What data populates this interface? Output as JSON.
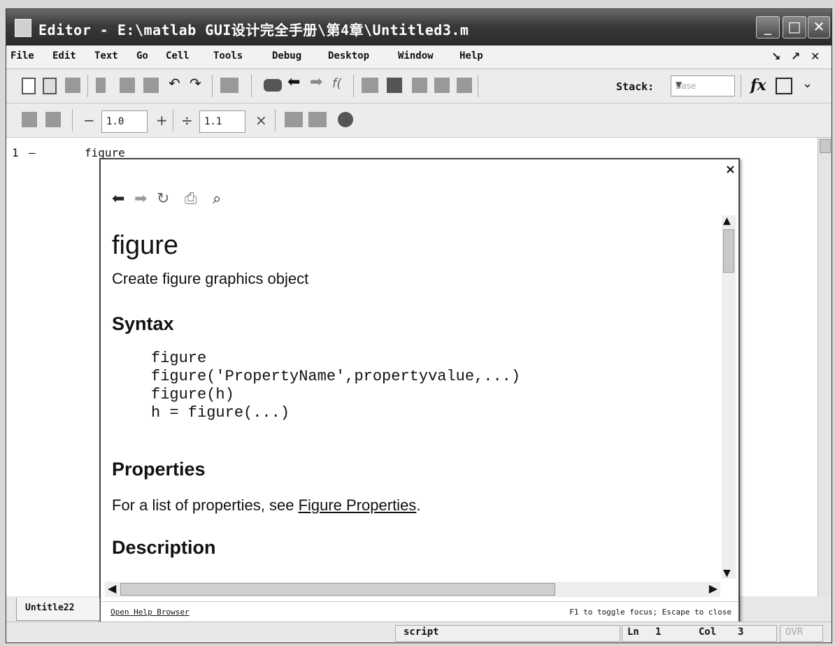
{
  "window": {
    "title": "Editor - E:\\matlab GUI设计完全手册\\第4章\\Untitled3.m",
    "controls": {
      "minimize": "_",
      "maximize": "□",
      "close": "✕"
    }
  },
  "menu": {
    "items": [
      "File",
      "Edit",
      "Text",
      "Go",
      "Cell",
      "Tools",
      "Debug",
      "Desktop",
      "Window",
      "Help"
    ],
    "right": [
      "↘",
      "↗",
      "✕"
    ]
  },
  "toolbar1": {
    "stack_label": "Stack:",
    "stack_value": "Base",
    "fx_label": "fx",
    "icons": [
      "new-file-icon",
      "open-file-icon",
      "save-icon",
      "cut-icon",
      "copy-icon",
      "paste-icon",
      "undo-icon",
      "redo-icon",
      "print-icon",
      "find-icon",
      "back-icon",
      "forward-icon",
      "function-icon",
      "run-icon",
      "breakpoint-icon",
      "step-icon",
      "step-in-icon",
      "step-out-icon"
    ]
  },
  "toolbar2": {
    "field1": "1.0",
    "field2": "1.1",
    "minus": "−",
    "plus": "+",
    "divide": "÷",
    "times": "×"
  },
  "editor": {
    "line_number": "1",
    "line_marker": "–",
    "code": "figure"
  },
  "help_popup": {
    "close": "×",
    "title": "figure",
    "subtitle": "Create figure graphics object",
    "syntax_heading": "Syntax",
    "syntax_lines": [
      "figure",
      "figure('PropertyName',propertyvalue,...)",
      "figure(h)",
      "h = figure(...)"
    ],
    "properties_heading": "Properties",
    "properties_text": "For a list of properties, see ",
    "properties_link": "Figure Properties",
    "properties_end": ".",
    "description_heading": "Description",
    "footer_link": "Open Help Browser",
    "footer_hint": "F1 to toggle focus; Escape to close"
  },
  "filetab": {
    "label": "Untitle22"
  },
  "status": {
    "mode": "script",
    "ln_label": "Ln",
    "ln_value": "1",
    "col_label": "Col",
    "col_value": "3",
    "ovr": "OVR"
  }
}
